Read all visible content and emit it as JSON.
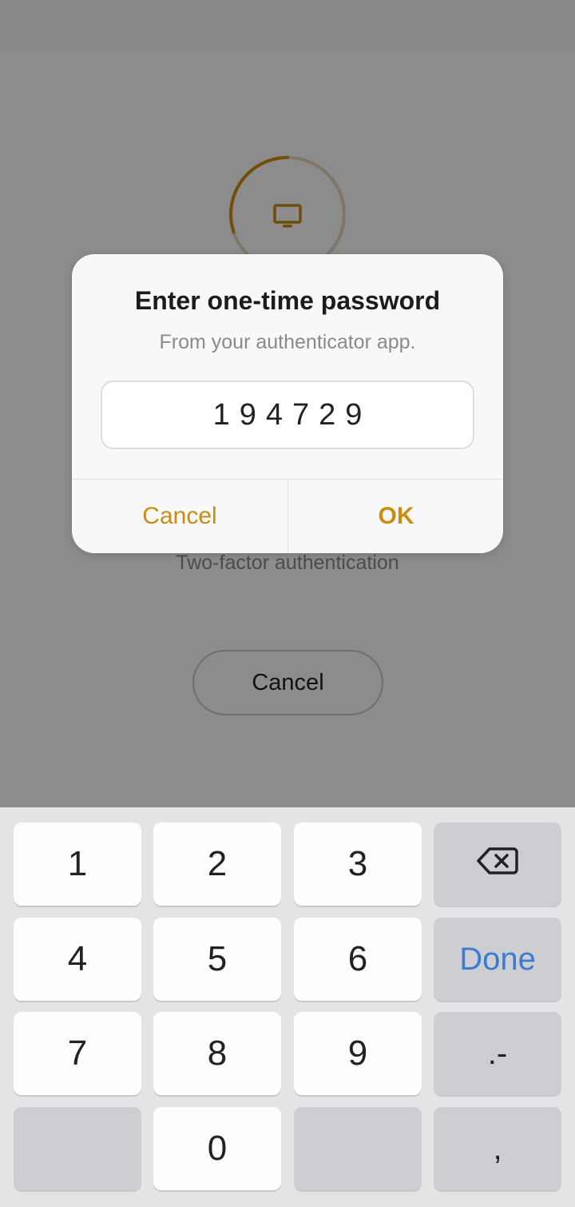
{
  "colors": {
    "accent": "#c98d12",
    "done_key": "#3d7ad6",
    "ring_track": "#e6d8bf",
    "ring_progress": "#d08e0c"
  },
  "background": {
    "icon": "monitor-icon",
    "progress_fraction": 0.3,
    "caption": "Two-factor authentication",
    "cancel_label": "Cancel"
  },
  "dialog": {
    "title": "Enter one-time password",
    "subtitle": "From your authenticator app.",
    "otp_value": "194729",
    "cancel_label": "Cancel",
    "ok_label": "OK"
  },
  "keypad": {
    "keys": [
      "1",
      "2",
      "3",
      "4",
      "5",
      "6",
      "7",
      "8",
      "9",
      "0"
    ],
    "backspace_icon": "backspace-icon",
    "done_label": "Done",
    "dot_dash_label": ".-",
    "comma_label": ","
  }
}
